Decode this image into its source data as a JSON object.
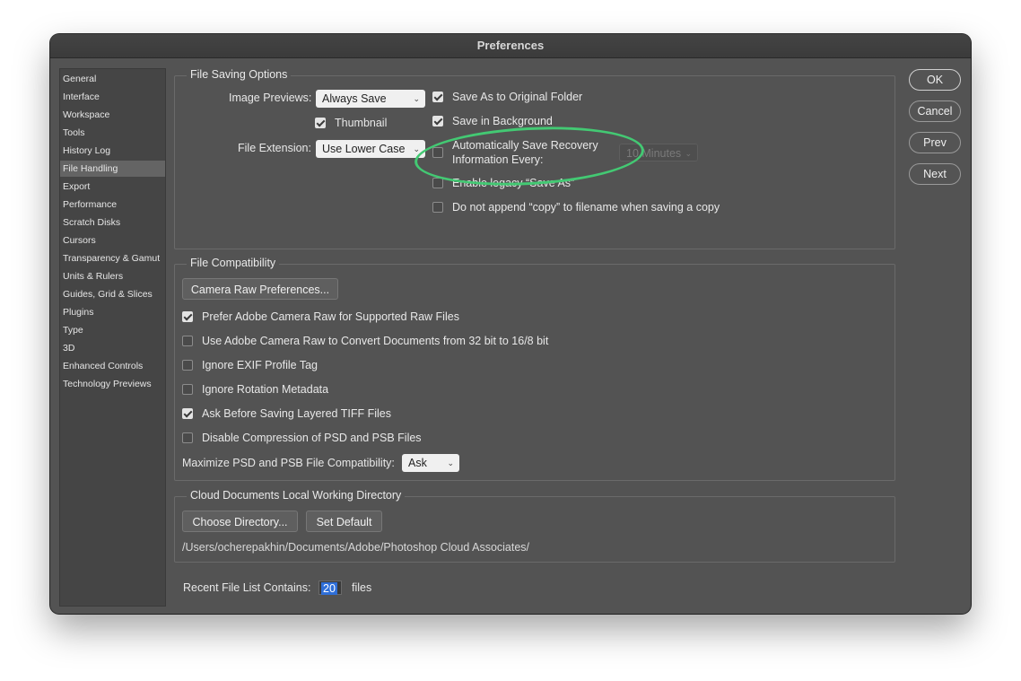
{
  "window": {
    "title": "Preferences"
  },
  "sidebar": {
    "items": [
      {
        "label": "General"
      },
      {
        "label": "Interface"
      },
      {
        "label": "Workspace"
      },
      {
        "label": "Tools"
      },
      {
        "label": "History Log"
      },
      {
        "label": "File Handling",
        "selected": true
      },
      {
        "label": "Export"
      },
      {
        "label": "Performance"
      },
      {
        "label": "Scratch Disks"
      },
      {
        "label": "Cursors"
      },
      {
        "label": "Transparency & Gamut"
      },
      {
        "label": "Units & Rulers"
      },
      {
        "label": "Guides, Grid & Slices"
      },
      {
        "label": "Plugins"
      },
      {
        "label": "Type"
      },
      {
        "label": "3D"
      },
      {
        "label": "Enhanced Controls"
      },
      {
        "label": "Technology Previews"
      }
    ]
  },
  "file_saving": {
    "title": "File Saving Options",
    "image_previews_label": "Image Previews:",
    "image_previews_value": "Always Save",
    "thumbnail_label": "Thumbnail",
    "thumbnail_checked": true,
    "file_extension_label": "File Extension:",
    "file_extension_value": "Use Lower Case",
    "save_as_original_label": "Save As to Original Folder",
    "save_as_original_checked": true,
    "save_background_label": "Save in Background",
    "save_background_checked": true,
    "auto_save_label_line1": "Automatically Save Recovery",
    "auto_save_label_line2": "Information Every:",
    "auto_save_checked": false,
    "auto_save_interval": "10 Minutes",
    "legacy_save_as_label": "Enable legacy “Save As”",
    "legacy_save_as_checked": false,
    "no_copy_label": "Do not append “copy” to filename when saving a copy",
    "no_copy_checked": false
  },
  "file_compat": {
    "title": "File Compatibility",
    "camera_raw_button": "Camera Raw Preferences...",
    "options": [
      {
        "label": "Prefer Adobe Camera Raw for Supported Raw Files",
        "checked": true
      },
      {
        "label": "Use Adobe Camera Raw to Convert Documents from 32 bit to 16/8 bit",
        "checked": false
      },
      {
        "label": "Ignore EXIF Profile Tag",
        "checked": false
      },
      {
        "label": "Ignore Rotation Metadata",
        "checked": false
      },
      {
        "label": "Ask Before Saving Layered TIFF Files",
        "checked": true
      },
      {
        "label": "Disable Compression of PSD and PSB Files",
        "checked": false
      }
    ],
    "maximize_label": "Maximize PSD and PSB File Compatibility:",
    "maximize_value": "Ask"
  },
  "cloud": {
    "title": "Cloud Documents Local Working Directory",
    "choose_button": "Choose Directory...",
    "default_button": "Set Default",
    "path": "/Users/ocherepakhin/Documents/Adobe/Photoshop Cloud Associates/"
  },
  "recent": {
    "label": "Recent File List Contains:",
    "value": "20",
    "suffix": "files"
  },
  "buttons": {
    "ok": "OK",
    "cancel": "Cancel",
    "prev": "Prev",
    "next": "Next"
  },
  "icons": {
    "chevron": "chevron-down-icon",
    "checkmark": "checkmark-icon"
  },
  "colors": {
    "highlight_ring": "#43c973",
    "selection": "#2f6fd8"
  }
}
